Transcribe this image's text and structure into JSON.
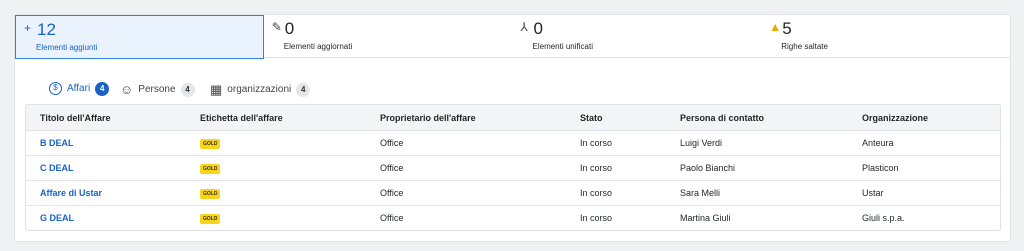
{
  "stats": [
    {
      "icon": "+",
      "icon_name": "plus-icon",
      "count": "12",
      "label": "Elementi aggiunti"
    },
    {
      "icon": "✎",
      "icon_name": "pencil-icon",
      "count": "0",
      "label": "Elementi aggiornati"
    },
    {
      "icon": "⅄",
      "icon_name": "merge-icon",
      "count": "0",
      "label": "Elementi unificati"
    },
    {
      "icon": "▲",
      "icon_name": "warning-icon",
      "count": "5",
      "label": "Righe saltate"
    }
  ],
  "tabs": [
    {
      "icon": "$",
      "icon_name": "dollar-circle-icon",
      "label": "Affari",
      "count": "4"
    },
    {
      "icon": "☺",
      "icon_name": "person-icon",
      "label": "Persone",
      "count": "4"
    },
    {
      "icon": "▦",
      "icon_name": "building-icon",
      "label": "organizzazioni",
      "count": "4"
    }
  ],
  "table": {
    "headers": [
      "Titolo dell'Affare",
      "Etichetta dell'affare",
      "Proprietario dell'affare",
      "Stato",
      "Persona di contatto",
      "Organizzazione"
    ],
    "rows": [
      [
        "B DEAL",
        "GOLD",
        "Office",
        "In corso",
        "Luigi Verdi",
        "Anteura"
      ],
      [
        "C DEAL",
        "GOLD",
        "Office",
        "In corso",
        "Paolo Bianchi",
        "Plasticon"
      ],
      [
        "Affare di Ustar",
        "GOLD",
        "Office",
        "In corso",
        "Sara Melli",
        "Ustar"
      ],
      [
        "G DEAL",
        "GOLD",
        "Office",
        "In corso",
        "Martina Giuli",
        "Giuli s.p.a."
      ]
    ]
  },
  "colors": {
    "accent": "#1a62c6",
    "tag": "#f7d51c",
    "warning": "#f0a400"
  }
}
